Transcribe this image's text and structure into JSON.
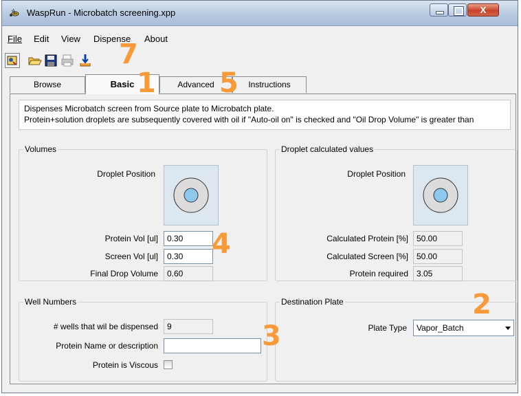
{
  "window": {
    "title": "WaspRun -  Microbatch screening.xpp",
    "controls": {
      "minimize": "",
      "maximize": "",
      "close": "X"
    }
  },
  "menu": {
    "items": [
      {
        "label": "File"
      },
      {
        "label": "Edit"
      },
      {
        "label": "View"
      },
      {
        "label": "Dispense"
      },
      {
        "label": "About"
      }
    ]
  },
  "toolbar": {
    "icons": [
      "wizard-icon",
      "open-folder-icon",
      "save-icon",
      "print-icon",
      "dispense-icon"
    ]
  },
  "tabs": [
    {
      "label": "Browse",
      "active": false
    },
    {
      "label": "Basic",
      "active": true
    },
    {
      "label": "Advanced",
      "active": false
    },
    {
      "label": "Instructions",
      "active": false
    }
  ],
  "description": {
    "line1": "Dispenses Microbatch screen from Source plate to Microbatch plate.",
    "line2": "Protein+solution droplets are subsequently covered with oil if \"Auto-oil on\" is checked and \"Oil Drop Volume\" is greater than"
  },
  "volumes": {
    "title": "Volumes",
    "droplet_position_label": "Droplet Position",
    "protein_vol_label": "Protein Vol [ul]",
    "protein_vol_value": "0.30",
    "screen_vol_label": "Screen Vol [ul]",
    "screen_vol_value": "0.30",
    "final_drop_label": "Final Drop Volume",
    "final_drop_value": "0.60"
  },
  "calculated": {
    "title": "Droplet calculated values",
    "droplet_position_label": "Droplet Position",
    "calc_protein_label": "Calculated Protein [%]",
    "calc_protein_value": "50.00",
    "calc_screen_label": "Calculated Screen [%]",
    "calc_screen_value": "50.00",
    "protein_required_label": "Protein required",
    "protein_required_value": "3.05"
  },
  "well_numbers": {
    "title": "Well Numbers",
    "wells_label": "# wells that wil be dispensed",
    "wells_value": "9",
    "protein_name_label": "Protein Name or description",
    "protein_name_value": "",
    "viscous_label": "Protein is Viscous",
    "viscous_checked": false
  },
  "destination": {
    "title": "Destination Plate",
    "plate_type_label": "Plate Type",
    "plate_type_value": "Vapor_Batch"
  },
  "annotations": {
    "n1": "1",
    "n2": "2",
    "n3": "3",
    "n4": "4",
    "n5": "5",
    "n7": "7",
    "color": "#f79a3a"
  },
  "colors": {
    "droplet_outer": "#dcdcdc",
    "droplet_inner": "#8ec8ee",
    "panel_bg": "#dde7ef"
  }
}
